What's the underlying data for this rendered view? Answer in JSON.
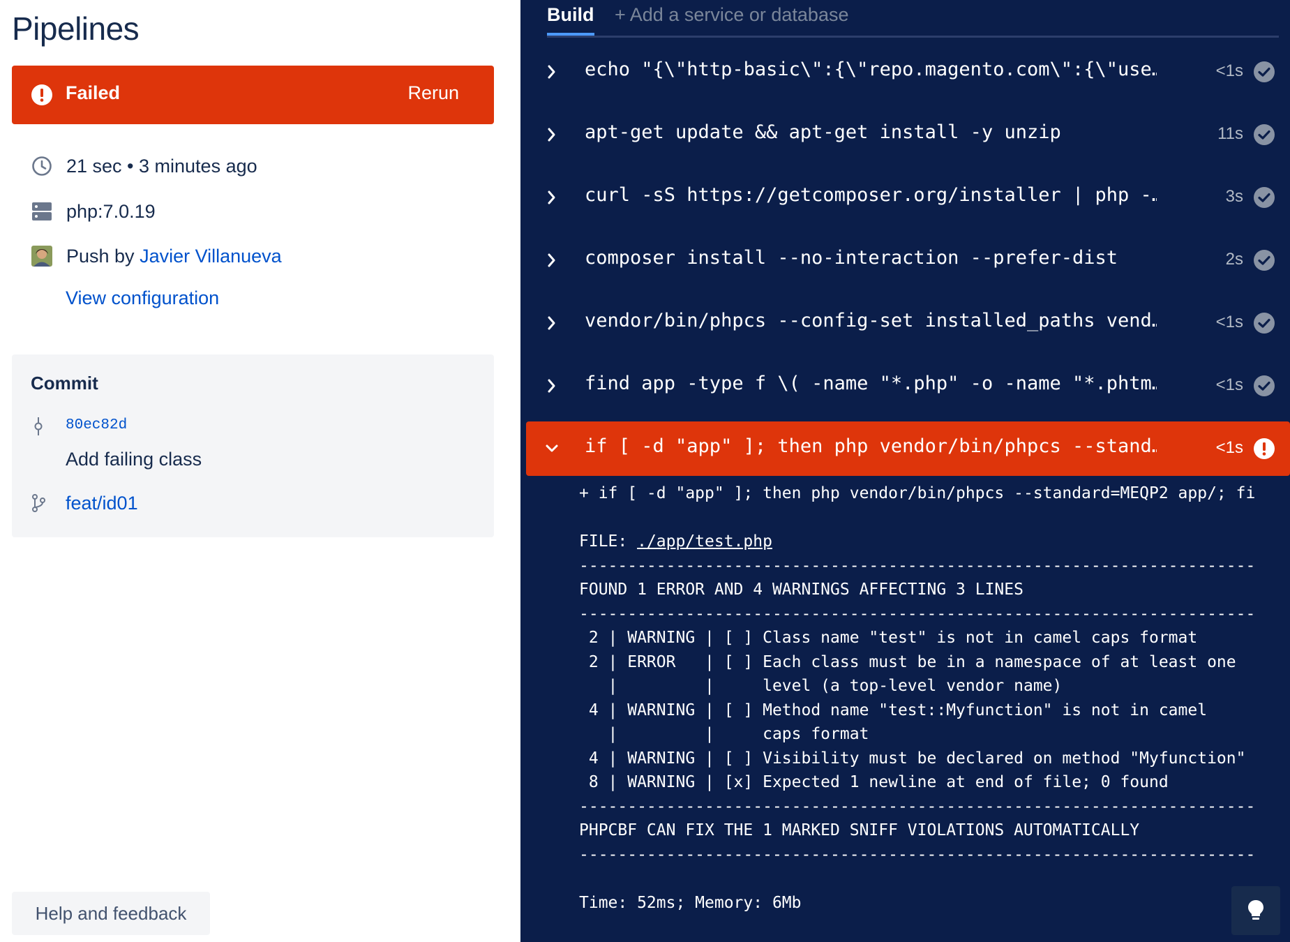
{
  "page": {
    "title": "Pipelines"
  },
  "status": {
    "label": "Failed",
    "rerun_label": "Rerun",
    "color": "#de350b"
  },
  "meta": {
    "duration": "21 sec • 3 minutes ago",
    "image": "php:7.0.19",
    "trigger_prefix": "Push by ",
    "author": "Javier Villanueva",
    "view_config_label": "View configuration"
  },
  "commit": {
    "title": "Commit",
    "hash": "80ec82d",
    "message": "Add failing class",
    "branch": "feat/id01"
  },
  "help": {
    "label": "Help and feedback"
  },
  "tabs": {
    "build": "Build",
    "add_service": "+ Add a service or database"
  },
  "steps": [
    {
      "command": "echo \"{\\\"http-basic\\\":{\\\"repo.magento.com\\\":{\\\"use…",
      "duration": "<1s",
      "state": "success"
    },
    {
      "command": "apt-get update && apt-get install -y unzip",
      "duration": "11s",
      "state": "success"
    },
    {
      "command": "curl -sS https://getcomposer.org/installer | php -…",
      "duration": "3s",
      "state": "success"
    },
    {
      "command": "composer install --no-interaction --prefer-dist",
      "duration": "2s",
      "state": "success"
    },
    {
      "command": "vendor/bin/phpcs --config-set installed_paths vend…",
      "duration": "<1s",
      "state": "success"
    },
    {
      "command": "find app -type f \\( -name \"*.php\" -o -name \"*.phtm…",
      "duration": "<1s",
      "state": "success"
    },
    {
      "command": "if [ -d \"app\" ]; then php vendor/bin/phpcs --stand…",
      "duration": "<1s",
      "state": "failed"
    }
  ],
  "log": {
    "lines": [
      "+ if [ -d \"app\" ]; then php vendor/bin/phpcs --standard=MEQP2 app/; fi",
      "",
      "FILE_LINE",
      "----------------------------------------------------------------------",
      "FOUND 1 ERROR AND 4 WARNINGS AFFECTING 3 LINES",
      "----------------------------------------------------------------------",
      " 2 | WARNING | [ ] Class name \"test\" is not in camel caps format",
      " 2 | ERROR   | [ ] Each class must be in a namespace of at least one",
      "   |         |     level (a top-level vendor name)",
      " 4 | WARNING | [ ] Method name \"test::Myfunction\" is not in camel",
      "   |         |     caps format",
      " 4 | WARNING | [ ] Visibility must be declared on method \"Myfunction\"",
      " 8 | WARNING | [x] Expected 1 newline at end of file; 0 found",
      "----------------------------------------------------------------------",
      "PHPCBF CAN FIX THE 1 MARKED SNIFF VIOLATIONS AUTOMATICALLY",
      "----------------------------------------------------------------------",
      "",
      "Time: 52ms; Memory: 6Mb"
    ],
    "file_prefix": "FILE: ",
    "file_path": "./app/test.php"
  }
}
